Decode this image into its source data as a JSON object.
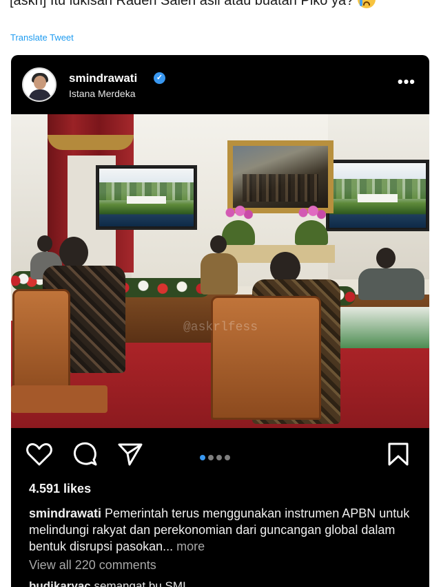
{
  "tweet": {
    "text": "[askrl] Itu lukisan Raden Saleh asli atau buatan Piko ya?",
    "translate_label": "Translate Tweet"
  },
  "post": {
    "username": "smindrawati",
    "location": "Istana Merdeka",
    "more_label": "•••",
    "verified_icon": "✓",
    "watermark": "@askrlfess",
    "likes": "4.591 likes",
    "caption_username": "smindrawati",
    "caption_text": " Pemerintah terus menggunakan instrumen APBN untuk melindungi rakyat dan perekonomian dari guncangan global dalam bentuk disrupsi pasokan... ",
    "caption_more": "more",
    "view_comments": "View all 220 comments",
    "comment_username": "budikaryac",
    "comment_text": " semangat bu SMI",
    "carousel": {
      "count": 4,
      "active": 1
    }
  },
  "icons": {
    "like": "heart-icon",
    "comment": "comment-icon",
    "share": "share-icon",
    "save": "bookmark-icon"
  },
  "colors": {
    "accent": "#3897f0",
    "link": "#1d9bf0",
    "card_bg": "#000000"
  }
}
